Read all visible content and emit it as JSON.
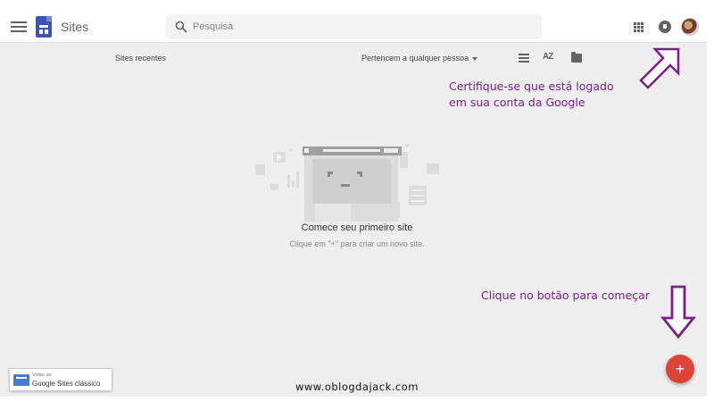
{
  "header": {
    "app_title": "Sites",
    "search_placeholder": "Pesquisa"
  },
  "toolbar": {
    "recent_label": "Sites recentes",
    "owner_filter": "Pertencem a qualquer pessoa",
    "sort_glyph": "AZ"
  },
  "empty_state": {
    "title": "Comece seu primeiro site",
    "subtitle": "Clique em \"+\" para criar um novo site."
  },
  "annotations": {
    "login_line1": "Certifique-se que está logado",
    "login_line2": "em sua conta da Google",
    "start_text": "Clique no botão para começar"
  },
  "classic": {
    "small": "Voltar ao",
    "label": "Google Sites clássico"
  },
  "fab": {
    "label": "+"
  },
  "watermark": "www.oblogdajack.com",
  "colors": {
    "accent_fab": "#db4437",
    "annotation": "#7b1f8c",
    "sites_logo": "#3f51b5"
  },
  "icons": [
    "menu-icon",
    "sites-logo",
    "search-icon",
    "apps-icon",
    "notifications-icon",
    "list-view-icon",
    "sort-az-icon",
    "folder-icon",
    "google-sites-classic-icon",
    "add-icon"
  ]
}
